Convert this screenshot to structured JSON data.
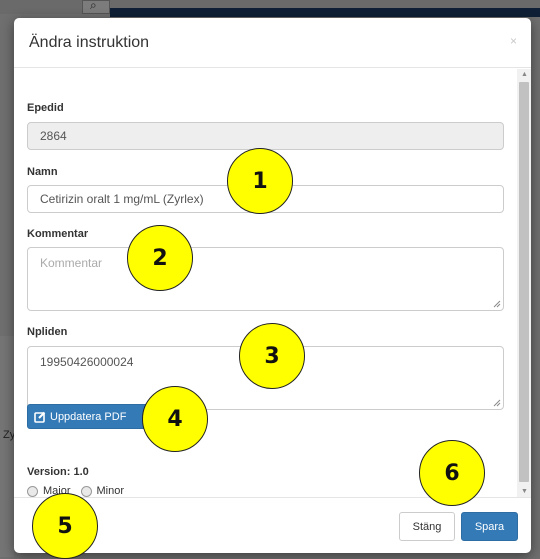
{
  "dialog": {
    "title": "Ändra instruktion",
    "close_glyph": "×"
  },
  "fields": {
    "epedid": {
      "label": "Epedid",
      "value": "2864"
    },
    "namn": {
      "label": "Namn",
      "value": "Cetirizin oralt 1 mg/mL (Zyrlex)"
    },
    "kommentar": {
      "label": "Kommentar",
      "placeholder": "Kommentar",
      "value": ""
    },
    "npliden": {
      "label": "Npliden",
      "value": "19950426000024"
    }
  },
  "pdf_button": {
    "label": "Uppdatera PDF",
    "icon": "edit-square-icon"
  },
  "version": {
    "label": "Version: 1.0",
    "options": [
      "Major",
      "Minor"
    ]
  },
  "footer": {
    "close_label": "Stäng",
    "save_label": "Spara"
  },
  "background": {
    "side_text": "Zy"
  },
  "annotations": [
    "1",
    "2",
    "3",
    "4",
    "5",
    "6"
  ],
  "colors": {
    "primary": "#337ab7",
    "callout": "#ffff00",
    "overlay": "#6f6f6f"
  }
}
